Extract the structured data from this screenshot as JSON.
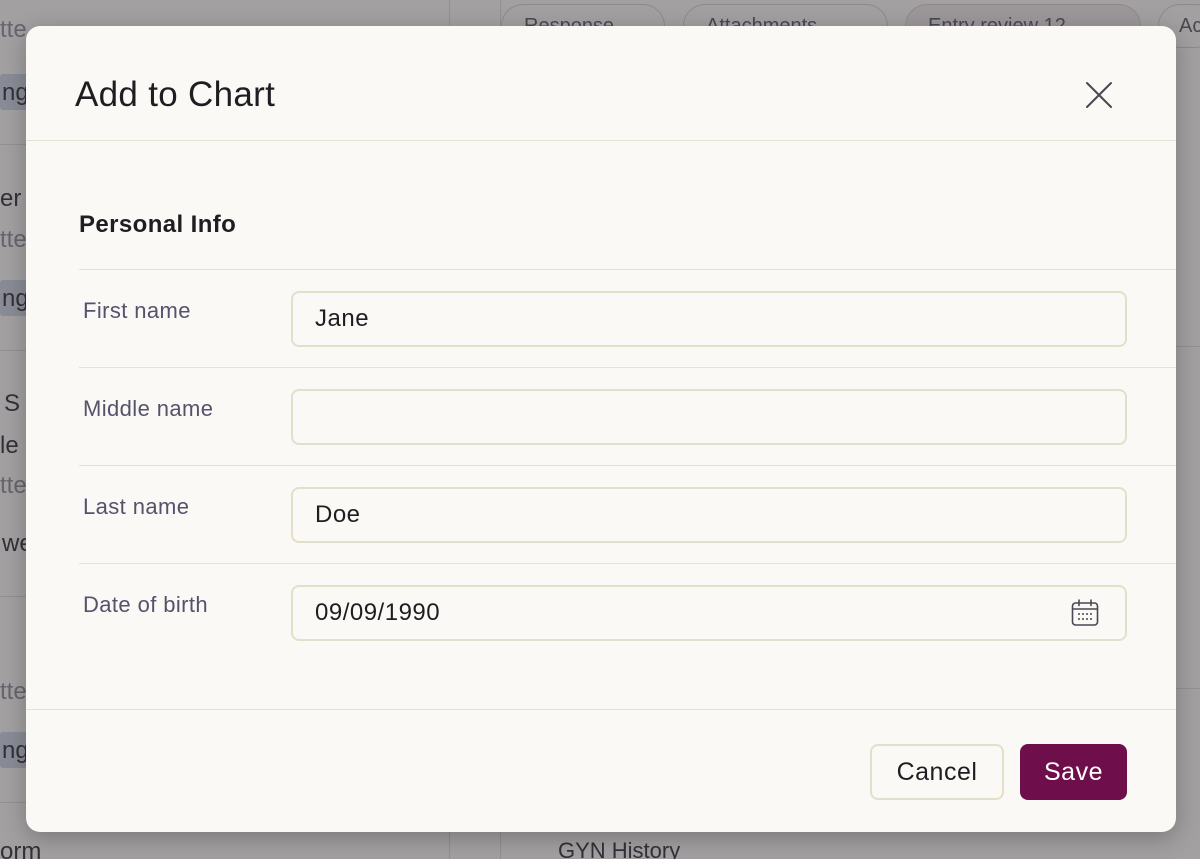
{
  "modal": {
    "title": "Add to Chart",
    "close_icon": "close-icon",
    "section_title": "Personal Info",
    "fields": [
      {
        "label": "First name",
        "value": "Jane",
        "placeholder": ""
      },
      {
        "label": "Middle name",
        "value": "",
        "placeholder": ""
      },
      {
        "label": "Last name",
        "value": "Doe",
        "placeholder": ""
      },
      {
        "label": "Date of birth",
        "value": "09/09/1990",
        "placeholder": "",
        "icon": "calendar-icon"
      }
    ],
    "buttons": {
      "cancel_label": "Cancel",
      "save_label": "Save"
    },
    "colors": {
      "accent": "#6e0f4b",
      "input_border": "#e4dfcb",
      "modal_background": "#faf9f6"
    }
  },
  "background": {
    "tabs": [
      "Response",
      "Attachments",
      "Entry review 12",
      "Ac"
    ],
    "left_fragments": [
      "tte",
      "ng",
      "er",
      "tte",
      "ng",
      "S",
      "le",
      "tte",
      "we",
      "tte",
      "ng",
      "orm"
    ],
    "bottom_right_text": "GYN History"
  }
}
